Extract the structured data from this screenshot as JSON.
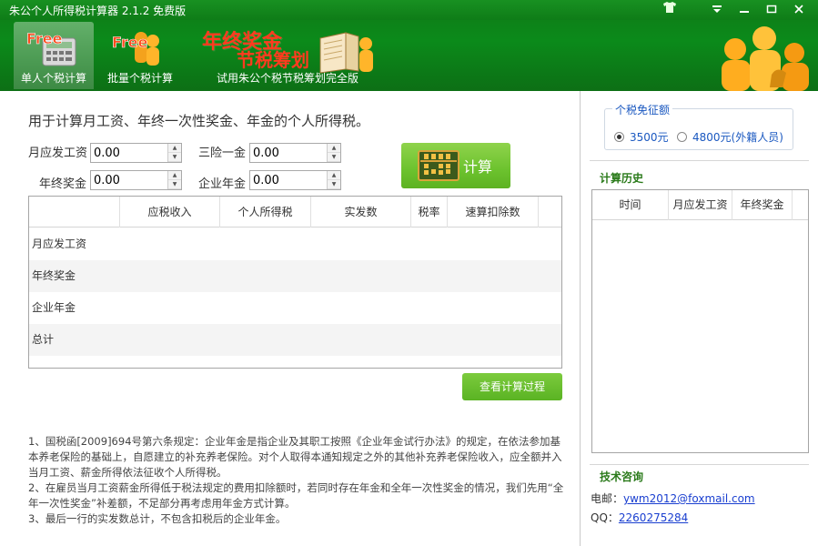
{
  "app": {
    "title": "朱公个人所得税计算器 2.1.2 免费版"
  },
  "window_controls": [
    "shirt-icon",
    "dropdown-icon",
    "minimize-icon",
    "maximize-icon",
    "close-icon"
  ],
  "nav": {
    "tabs": [
      {
        "label": "单人个税计算",
        "icon": "free-calculator-icon",
        "active": true
      },
      {
        "label": "批量个税计算",
        "icon": "free-people-icon",
        "active": false
      },
      {
        "label": "试用朱公个税节税筹划完全版",
        "icon": "book-people-icon",
        "active": false
      }
    ],
    "promo_line1": "年终奖金",
    "promo_line2": "节税筹划",
    "badge_text": "Free"
  },
  "main": {
    "heading": "用于计算月工资、年终一次性奖金、年金的个人所得税。",
    "fields": {
      "monthly_salary": {
        "label": "月应发工资",
        "value": "0.00"
      },
      "social_insurance": {
        "label": "三险一金",
        "value": "0.00"
      },
      "year_end_bonus": {
        "label": "年终奖金",
        "value": "0.00"
      },
      "enterprise_annuity": {
        "label": "企业年金",
        "value": "0.00"
      }
    },
    "calc_button": "计算",
    "table": {
      "columns": [
        "",
        "应税收入",
        "个人所得税",
        "实发数",
        "税率",
        "速算扣除数"
      ],
      "rows": [
        "月应发工资",
        "年终奖金",
        "企业年金",
        "总计"
      ]
    },
    "process_button": "查看计算过程",
    "notes": [
      "1、国税函[2009]694号第六条规定：企业年金是指企业及其职工按照《企业年金试行办法》的规定，在依法参加基本养老保险的基础上，自愿建立的补充养老保险。对个人取得本通知规定之外的其他补充养老保险收入，应全额并入当月工资、薪金所得依法征收个人所得税。",
      "2、在雇员当月工资薪金所得低于税法规定的费用扣除额时，若同时存在年金和全年一次性奖金的情况，我们先用“全年一次性奖金”补差额，不足部分再考虑用年金方式计算。",
      "3、最后一行的实发数总计，不包含扣税后的企业年金。"
    ]
  },
  "sidebar": {
    "exemption": {
      "legend": "个税免征额",
      "options": [
        {
          "label": "3500元",
          "selected": true
        },
        {
          "label": "4800元(外籍人员)",
          "selected": false
        }
      ]
    },
    "history": {
      "title": "计算历史",
      "columns": [
        "时间",
        "月应发工资",
        "年终奖金"
      ]
    },
    "support": {
      "title": "技术咨询",
      "email_label": "电邮：",
      "email": "ywm2012@foxmail.com",
      "qq_label": "QQ：",
      "qq": "2260275284"
    }
  },
  "colors": {
    "header_green": "#0b8a1a",
    "button_green": "#6cc22e",
    "link_blue": "#1a3fd0",
    "accent_blue": "#1a58c0",
    "promo_red": "#ff3b1f"
  }
}
